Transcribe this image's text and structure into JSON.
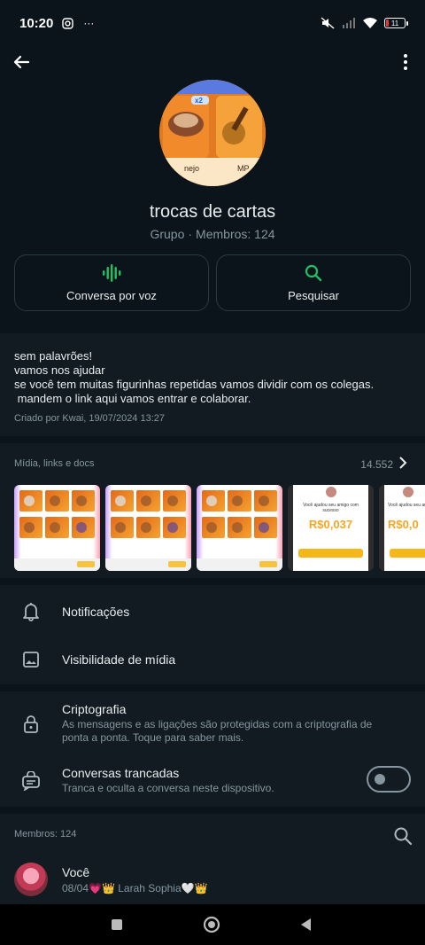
{
  "status_bar": {
    "time": "10:20",
    "battery": "11"
  },
  "group": {
    "name": "trocas de cartas",
    "type": "Grupo",
    "separator": "·",
    "members_label": "Membros: 124",
    "avatar_badge": "x2",
    "avatar_caption_left": "nejo",
    "avatar_caption_right": "MP"
  },
  "actions": {
    "voice_label": "Conversa por voz",
    "search_label": "Pesquisar"
  },
  "description": {
    "lines": [
      "sem palavrões!",
      "vamos nos ajudar",
      "se você tem muitas figurinhas repetidas vamos dividir com os colegas.",
      " mandem o link aqui vamos entrar e colaborar."
    ],
    "created": "Criado por Kwai, 19/07/2024 13:27"
  },
  "media": {
    "header": "Mídia, links e docs",
    "count": "14.552",
    "promo_value": "R$0,037",
    "promo_text": "Você ajudou seu amigo com sucesso",
    "promo_value_partial": "R$0,0"
  },
  "settings": {
    "notifications": "Notificações",
    "media_visibility": "Visibilidade de mídia",
    "encryption_title": "Criptografia",
    "encryption_sub": "As mensagens e as ligações são protegidas com a criptografia de ponta a ponta. Toque para saber mais.",
    "locked_title": "Conversas trancadas",
    "locked_sub": "Tranca e oculta a conversa neste dispositivo.",
    "locked_enabled": false
  },
  "members": {
    "header": "Membros: 124",
    "items": [
      {
        "name": "Você",
        "status": "08/04💗👑 Larah Sophia🤍👑"
      }
    ]
  },
  "colors": {
    "background": "#0b141a",
    "panel": "#111b21",
    "accent_green": "#00a884",
    "muted": "#8696a0"
  }
}
